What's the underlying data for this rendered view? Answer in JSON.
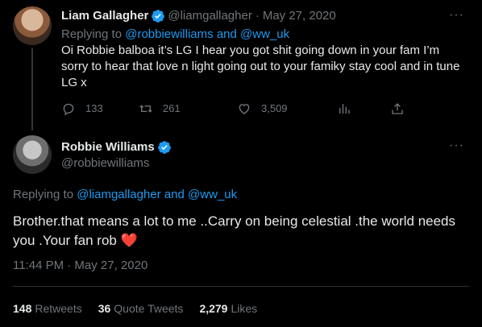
{
  "tweet1": {
    "name": "Liam Gallagher",
    "handle": "@liamgallagher",
    "dot": "·",
    "date": "May 27, 2020",
    "replying_prefix": "Replying to",
    "reply_mention1": "@robbiewilliams",
    "reply_and": "and",
    "reply_mention2": "@ww_uk",
    "text": "Oi Robbie balboa it’s LG I hear you got shit going down in your fam I’m sorry to hear that love n light going out to your famiky stay cool and in tune LG x",
    "replies": "133",
    "retweets": "261",
    "likes": "3,509",
    "more": "···"
  },
  "tweet2": {
    "name": "Robbie Williams",
    "handle": "@robbiewilliams",
    "replying_prefix": "Replying to",
    "reply_mention1": "@liamgallagher",
    "reply_and": "and",
    "reply_mention2": "@ww_uk",
    "text": "Brother.that means a lot to me ..Carry on being celestial .the world needs you .Your fan rob",
    "emoji": "❤️",
    "timestamp": "11:44 PM · May 27, 2020",
    "more": "···"
  },
  "stats": {
    "retweets_count": "148",
    "retweets_label": "Retweets",
    "quotes_count": "36",
    "quotes_label": "Quote Tweets",
    "likes_count": "2,279",
    "likes_label": "Likes"
  },
  "colors": {
    "background": "#000000",
    "text": "#e7e9ea",
    "muted": "#71767b",
    "link": "#1d9bf0",
    "verified": "#1d9bf0"
  }
}
